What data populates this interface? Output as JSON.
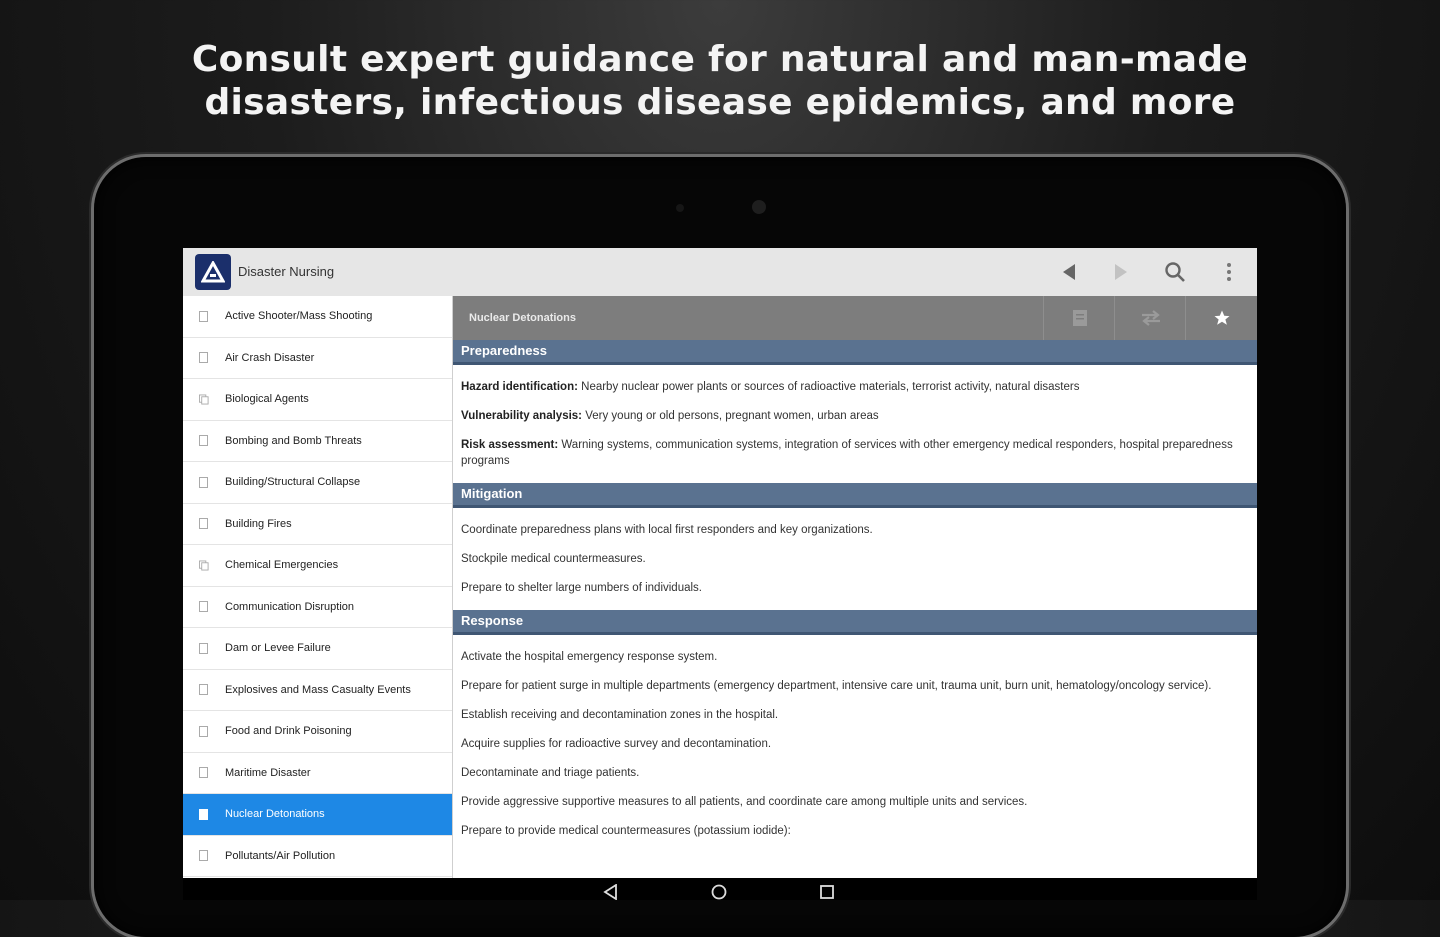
{
  "headline": {
    "line1": "Consult expert guidance for natural and man-made",
    "line2": "disasters, infectious disease epidemics, and more"
  },
  "app": {
    "title": "Disaster Nursing",
    "icons": [
      "back-arrow-icon",
      "forward-arrow-icon",
      "search-icon",
      "overflow-menu-icon"
    ]
  },
  "sidebar": {
    "items": [
      {
        "label": "Active Shooter/Mass Shooting",
        "icon": "document-icon"
      },
      {
        "label": "Air Crash Disaster",
        "icon": "document-icon"
      },
      {
        "label": "Biological Agents",
        "icon": "documents-icon"
      },
      {
        "label": "Bombing and Bomb Threats",
        "icon": "document-icon"
      },
      {
        "label": "Building/Structural Collapse",
        "icon": "document-icon"
      },
      {
        "label": "Building Fires",
        "icon": "document-icon"
      },
      {
        "label": "Chemical Emergencies",
        "icon": "documents-icon"
      },
      {
        "label": "Communication Disruption",
        "icon": "document-icon"
      },
      {
        "label": "Dam or Levee Failure",
        "icon": "document-icon"
      },
      {
        "label": "Explosives and Mass Casualty Events",
        "icon": "document-icon"
      },
      {
        "label": "Food and Drink Poisoning",
        "icon": "document-icon"
      },
      {
        "label": "Maritime Disaster",
        "icon": "document-icon"
      },
      {
        "label": "Nuclear Detonations",
        "icon": "document-icon",
        "selected": true
      },
      {
        "label": "Pollutants/Air Pollution",
        "icon": "document-icon"
      }
    ]
  },
  "content": {
    "title": "Nuclear Detonations",
    "toolbar_icons": [
      "notes-icon",
      "swap-icon",
      "favorite-star-icon"
    ],
    "sections": {
      "preparedness": {
        "heading": "Preparedness",
        "items": [
          {
            "label": "Hazard identification:",
            "text": " Nearby nuclear power plants or sources of radioactive materials, terrorist activity, natural disasters"
          },
          {
            "label": "Vulnerability analysis:",
            "text": " Very young or old persons, pregnant women, urban areas"
          },
          {
            "label": "Risk assessment:",
            "text": " Warning systems, communication systems, integration of services with other emergency medical responders, hospital preparedness programs"
          }
        ]
      },
      "mitigation": {
        "heading": "Mitigation",
        "items": [
          "Coordinate preparedness plans with local first responders and key organizations.",
          "Stockpile medical countermeasures.",
          "Prepare to shelter large numbers of individuals."
        ]
      },
      "response": {
        "heading": "Response",
        "items": [
          "Activate the hospital emergency response system.",
          "Prepare for patient surge in multiple departments (emergency department, intensive care unit, trauma unit, burn unit, hematology/oncology service).",
          "Establish receiving and decontamination zones in the hospital.",
          "Acquire supplies for radioactive survey and decontamination.",
          "Decontaminate and triage patients.",
          "Provide aggressive supportive measures to all patients, and coordinate care among multiple units and services.",
          "Prepare to provide medical countermeasures (potassium iodide):"
        ]
      }
    }
  },
  "navbar": {
    "icons": [
      "nav-back-icon",
      "nav-home-icon",
      "nav-recents-icon"
    ]
  },
  "colors": {
    "section_header": "#5a7290",
    "selected_item": "#1e88e5",
    "app_logo": "#1b2f6b",
    "toolbar": "#7d7d7d"
  }
}
